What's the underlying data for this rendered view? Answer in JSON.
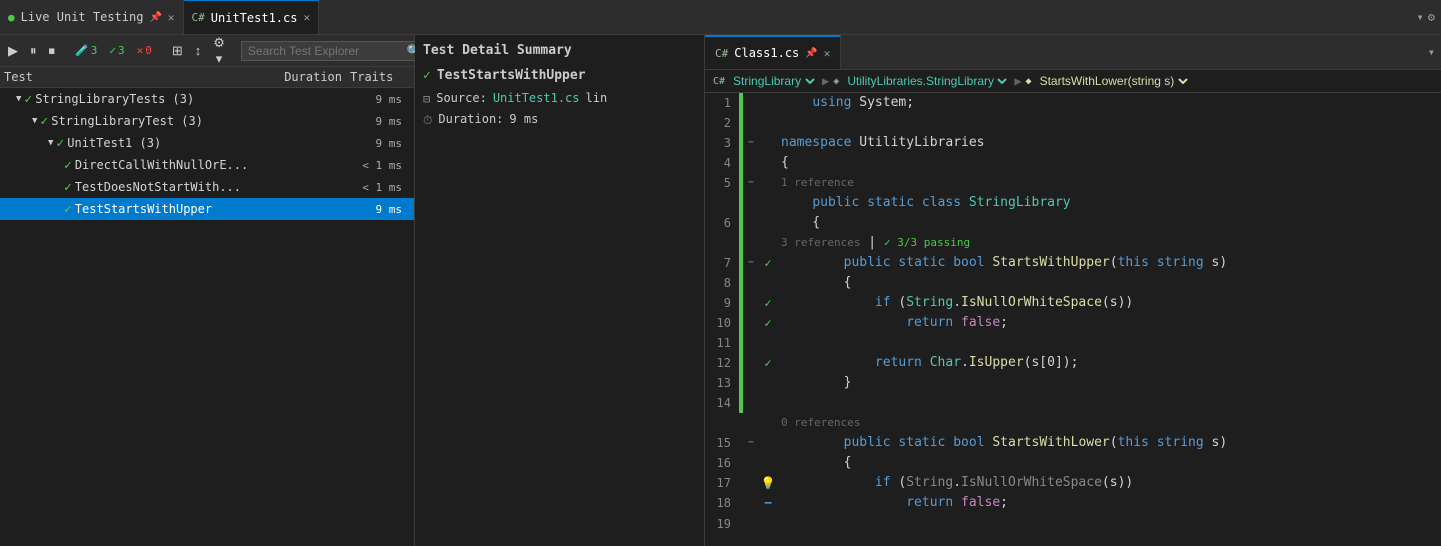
{
  "tabs": [
    {
      "label": "Live Unit Testing",
      "active": false,
      "pinned": true,
      "icon": "live-testing-icon"
    },
    {
      "label": "UnitTest1.cs",
      "active": true,
      "icon": "cs-file-icon"
    }
  ],
  "toolbar": {
    "play_label": "▶",
    "pause_label": "⏸",
    "stop_label": "⏹",
    "flask_label": "🧪",
    "pass_count": "3",
    "fail_count": "3",
    "error_count": "0",
    "group_label": "⊞",
    "sort_label": "↕",
    "settings_label": "⚙",
    "search_placeholder": "Search Test Explorer"
  },
  "columns": {
    "test": "Test",
    "duration": "Duration",
    "traits": "Traits"
  },
  "tree": [
    {
      "id": "r1",
      "indent": 0,
      "label": "StringLibraryTests (3)",
      "duration": "9 ms",
      "pass": true,
      "collapse": true
    },
    {
      "id": "r2",
      "indent": 1,
      "label": "StringLibraryTest (3)",
      "duration": "9 ms",
      "pass": true,
      "collapse": true
    },
    {
      "id": "r3",
      "indent": 2,
      "label": "UnitTest1 (3)",
      "duration": "9 ms",
      "pass": true,
      "collapse": true
    },
    {
      "id": "r4",
      "indent": 3,
      "label": "DirectCallWithNullOrE...",
      "duration": "< 1 ms",
      "pass": true,
      "collapse": false
    },
    {
      "id": "r5",
      "indent": 3,
      "label": "TestDoesNotStartWith...",
      "duration": "< 1 ms",
      "pass": true,
      "collapse": false
    },
    {
      "id": "r6",
      "indent": 3,
      "label": "TestStartsWithUpper",
      "duration": "9 ms",
      "pass": true,
      "collapse": false,
      "selected": true
    }
  ],
  "detail": {
    "title": "Test Detail Summary",
    "test_name": "TestStartsWithUpper",
    "source_label": "Source:",
    "source_link": "UnitTest1.cs",
    "source_suffix": "lin",
    "duration_label": "Duration:",
    "duration_value": "9 ms"
  },
  "editor": {
    "tabs": [
      {
        "label": "Class1.cs",
        "active": true,
        "pinned": true
      },
      {
        "label": "",
        "active": false
      }
    ],
    "breadcrumb": {
      "class": "StringLibrary",
      "namespace": "UtilityLibraries.StringLibrary",
      "method": "StartsWithLower(string s)"
    },
    "lines": [
      {
        "num": 1,
        "green": true,
        "collapse": "",
        "gutter": "",
        "code": "    <kw>using</kw> System;"
      },
      {
        "num": 2,
        "green": true,
        "collapse": "",
        "gutter": "",
        "code": ""
      },
      {
        "num": 3,
        "green": true,
        "collapse": "[-]",
        "gutter": "",
        "code": "<kw>namespace</kw> UtilityLibraries"
      },
      {
        "num": 4,
        "green": true,
        "collapse": "",
        "gutter": "",
        "code": "{"
      },
      {
        "num": 5,
        "green": true,
        "collapse": "[-]",
        "gutter": "",
        "ref": "1 reference",
        "code": "    <kw>public</kw> <kw>static</kw> <kw>class</kw> <type>StringLibrary</type>"
      },
      {
        "num": 6,
        "green": true,
        "collapse": "",
        "gutter": "",
        "code": "    {"
      },
      {
        "num": 7,
        "green": true,
        "collapse": "[-]",
        "gutter": "✓",
        "ref": "3 references",
        "pass": "3/3 passing",
        "code": "        <kw>public</kw> <kw>static</kw> <kw>bool</kw> <method>StartsWithUpper</method>(<kw>this</kw> <kw>string</kw> s)"
      },
      {
        "num": 8,
        "green": true,
        "collapse": "",
        "gutter": "",
        "code": "        {"
      },
      {
        "num": 9,
        "green": true,
        "collapse": "",
        "gutter": "✓",
        "code": "            <kw>if</kw> (<type>String</type>.<method>IsNullOrWhiteSpace</method>(s))"
      },
      {
        "num": 10,
        "green": true,
        "collapse": "",
        "gutter": "✓",
        "code": "                <kw>return</kw> <kw2>false</kw2>;"
      },
      {
        "num": 11,
        "green": true,
        "collapse": "",
        "gutter": "",
        "code": ""
      },
      {
        "num": 12,
        "green": true,
        "collapse": "",
        "gutter": "✓",
        "code": "            <kw>return</kw> <type>Char</type>.<method>IsUpper</method>(s[0]);"
      },
      {
        "num": 13,
        "green": true,
        "collapse": "",
        "gutter": "",
        "code": "        }"
      },
      {
        "num": 14,
        "green": true,
        "collapse": "",
        "gutter": "",
        "code": ""
      },
      {
        "num": 15,
        "green": false,
        "collapse": "[-]",
        "gutter": "",
        "ref": "0 references",
        "code": "        <kw>public</kw> <kw>static</kw> <kw>bool</kw> <method>StartsWithLower</method>(<kw>this</kw> <kw>string</kw> s)"
      },
      {
        "num": 16,
        "green": false,
        "collapse": "",
        "gutter": "",
        "code": "        {"
      },
      {
        "num": 17,
        "green": false,
        "collapse": "",
        "gutter": "💡",
        "code": "            <kw>if</kw> (<type>String</type>.<method>IsNullOrWhiteSpace</method>(s))"
      },
      {
        "num": 18,
        "green": false,
        "collapse": "",
        "gutter": "−",
        "code": "                <kw>return</kw> <kw2>false</kw2>;"
      },
      {
        "num": 19,
        "green": false,
        "collapse": "",
        "gutter": "",
        "code": ""
      }
    ]
  }
}
